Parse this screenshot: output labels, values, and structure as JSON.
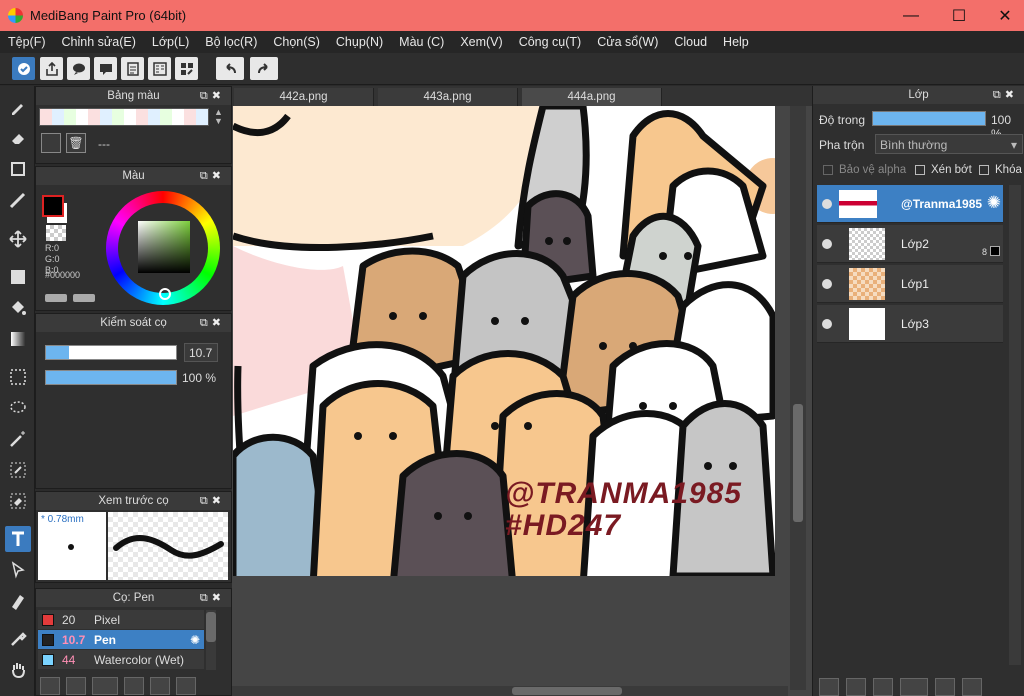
{
  "window": {
    "title": "MediBang Paint Pro (64bit)",
    "minimize": "—",
    "maximize": "☐",
    "close": "✕"
  },
  "menu": [
    "Tệp(F)",
    "Chỉnh sửa(E)",
    "Lớp(L)",
    "Bộ lọc(R)",
    "Chọn(S)",
    "Chụp(N)",
    "Màu (C)",
    "Xem(V)",
    "Công cụ(T)",
    "Cửa sổ(W)",
    "Cloud",
    "Help"
  ],
  "tabs": [
    "442a.png",
    "443a.png",
    "444a.png"
  ],
  "palette_panel": {
    "title": "Bảng màu",
    "name_value": "---"
  },
  "color_panel": {
    "title": "Màu",
    "r": "R:0",
    "g": "G:0",
    "b": "B:0",
    "hex": "#000000",
    "fg_color": "#000000",
    "bg_color": "#ffffff"
  },
  "brush_control": {
    "title": "Kiểm soát cọ",
    "size_value": "10.7",
    "opacity_value": "100 %",
    "size_fill": 0.18,
    "opacity_fill": 1.0
  },
  "brush_preview": {
    "title": "Xem trước cọ",
    "size_label": "* 0.78mm"
  },
  "brush_list": {
    "title": "Cọ: Pen",
    "items": [
      {
        "size": "20",
        "name": "Pixel",
        "color": "#e33b3b"
      },
      {
        "size": "10.7",
        "name": "Pen",
        "color": "#222222",
        "selected": true
      },
      {
        "size": "44",
        "name": "Watercolor (Wet)",
        "color": "#7ad3ff"
      }
    ]
  },
  "layers": {
    "title": "Lớp",
    "opacity_label": "Độ trong",
    "opacity_value": "100 %",
    "opacity_fill": 1.0,
    "blend_label": "Pha trộn",
    "blend_value": "Bình thường",
    "protect_alpha": "Bảo vệ alpha",
    "clipping": "Xén bớt",
    "lock": "Khóa",
    "items": [
      {
        "name": "@Tranma1985",
        "selected": true
      },
      {
        "name": "Lớp2",
        "badge": "8"
      },
      {
        "name": "Lớp1"
      },
      {
        "name": "Lớp3"
      }
    ]
  },
  "canvas": {
    "watermark_line1": "@TRANMA1985",
    "watermark_line2": "#HD247",
    "watermark_color": "#7a1a22"
  }
}
